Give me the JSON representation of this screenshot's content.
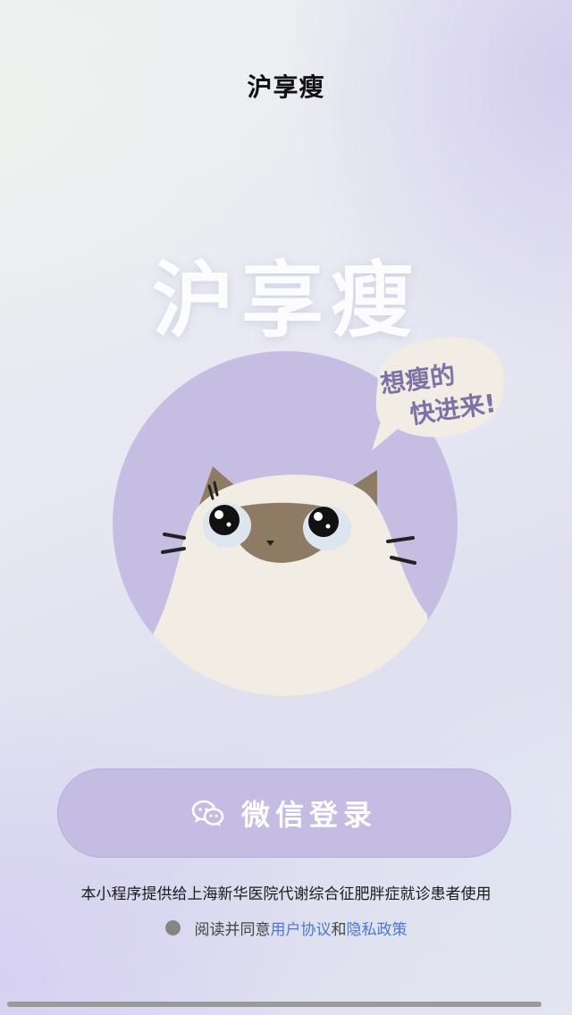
{
  "header": {
    "title": "沪享瘦"
  },
  "hero": {
    "title": "沪享瘦"
  },
  "mascot": {
    "bubble_line1": "想瘦的",
    "bubble_line2": "快进来!"
  },
  "login": {
    "label": "微信登录",
    "icon": "wechat-icon"
  },
  "disclaimer": "本小程序提供给上海新华医院代谢综合征肥胖症就诊患者使用",
  "agreement": {
    "prefix": "阅读并同意",
    "user_agreement": "用户协议",
    "conjunction": "和",
    "privacy_policy": "隐私政策",
    "checked": false
  },
  "colors": {
    "accent_purple": "#c4bce2",
    "link_blue": "#4a78d8",
    "cat_body": "#f1ece4",
    "cat_mask": "#8d7b63"
  }
}
